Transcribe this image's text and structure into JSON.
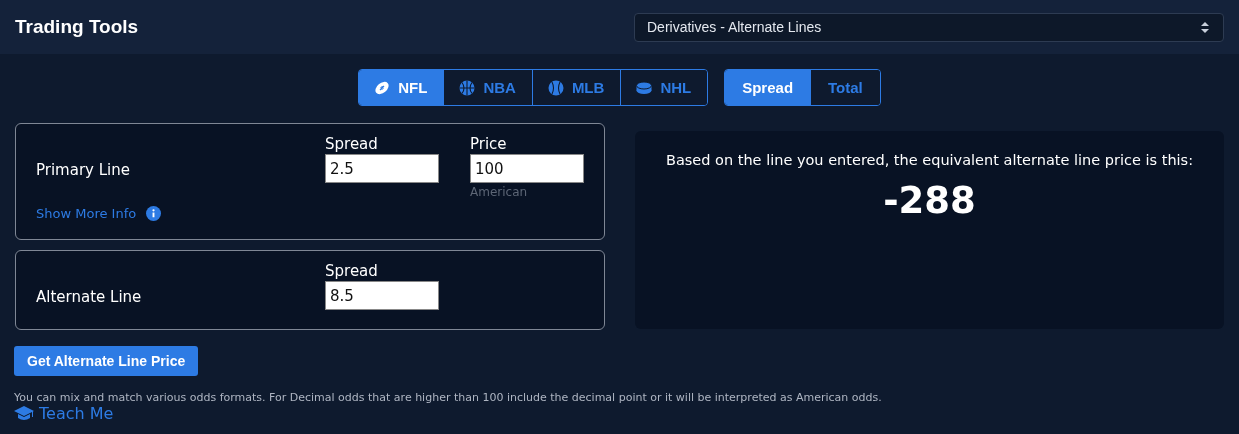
{
  "header": {
    "title": "Trading Tools",
    "tool_select": {
      "value": "Derivatives - Alternate Lines"
    }
  },
  "sports": [
    {
      "label": "NFL",
      "selected": true
    },
    {
      "label": "NBA",
      "selected": false
    },
    {
      "label": "MLB",
      "selected": false
    },
    {
      "label": "NHL",
      "selected": false
    }
  ],
  "bet_types": [
    {
      "label": "Spread",
      "selected": true
    },
    {
      "label": "Total",
      "selected": false
    }
  ],
  "primary_line": {
    "label": "Primary Line",
    "fields": [
      {
        "label": "Spread",
        "value": "2.5"
      },
      {
        "label": "Price",
        "value": "100",
        "hint": "American"
      }
    ],
    "link": "Show More Info"
  },
  "alternate_line": {
    "label": "Alternate Line",
    "fields": [
      {
        "label": "Spread",
        "value": "8.5"
      }
    ]
  },
  "result": {
    "text": "Based on the line you entered, the equivalent alternate line price is this:",
    "value": "-288"
  },
  "submit_button": "Get Alternate Line Price",
  "note": "You can mix and match various odds formats. For Decimal odds that are higher than 100 include the decimal point or it will be interpreted as American odds.",
  "teach_link": "Teach Me"
}
